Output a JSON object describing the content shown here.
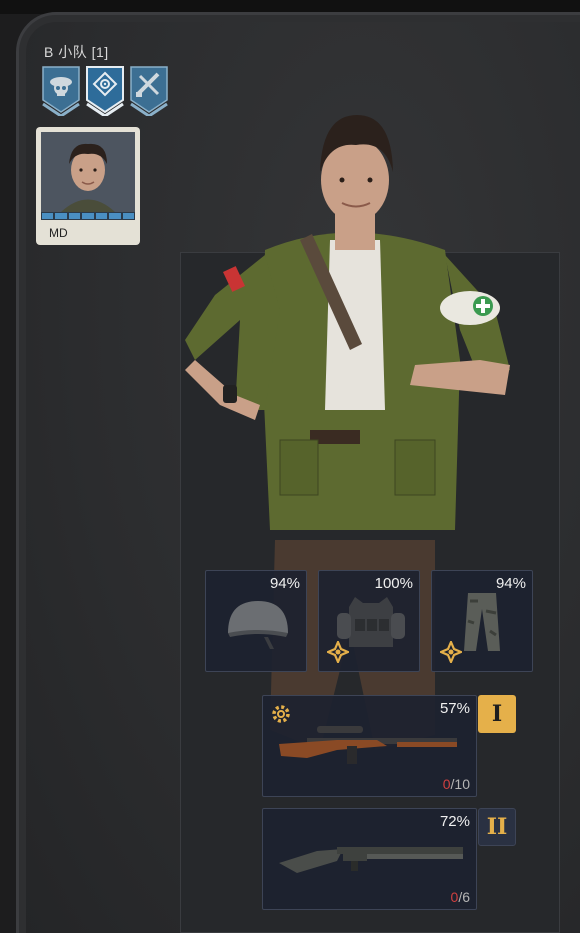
{
  "squad": {
    "title": "B 小队 [1]"
  },
  "roles": [
    {
      "name": "skull-helmet-icon",
      "active": false
    },
    {
      "name": "crosshair-icon",
      "active": true
    },
    {
      "name": "crossed-guns-icon",
      "active": false
    }
  ],
  "portrait": {
    "name": "MD",
    "pips": 7
  },
  "armor": [
    {
      "name": "helmet",
      "icon": "helmet-icon",
      "durability": "94%"
    },
    {
      "name": "vest",
      "icon": "vest-icon",
      "durability": "100%"
    },
    {
      "name": "pants",
      "icon": "pants-icon",
      "durability": "94%"
    }
  ],
  "weapons": {
    "primary": {
      "icon": "sniper-rifle-icon",
      "durability": "57%",
      "ammo_current": "0",
      "ammo_max": "/10",
      "tag": "I"
    },
    "secondary": {
      "icon": "shotgun-icon",
      "durability": "72%",
      "ammo_current": "0",
      "ammo_max": "/6",
      "tag": "II"
    }
  },
  "colors": {
    "accent": "#e5b04a",
    "ammo_empty": "#d04040",
    "role_active": "#2e6c9a"
  }
}
